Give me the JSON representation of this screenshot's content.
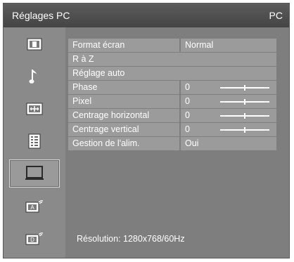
{
  "header": {
    "title": "Réglages PC",
    "source": "PC"
  },
  "sidebar": {
    "items": [
      {
        "icon": "picture-icon"
      },
      {
        "icon": "music-note-icon"
      },
      {
        "icon": "screen-adjust-icon"
      },
      {
        "icon": "feature-list-icon"
      },
      {
        "icon": "pc-monitor-icon",
        "selected": true
      },
      {
        "icon": "analog-setup-icon",
        "badge": "A"
      },
      {
        "icon": "digital-setup-icon",
        "badge": "D"
      }
    ]
  },
  "menu": {
    "rows": [
      {
        "label": "Format écran",
        "value": "Normal"
      },
      {
        "label": "R à Z"
      },
      {
        "label": "Réglage auto"
      },
      {
        "label": "Phase",
        "value": "0",
        "slider_level": 0.5
      },
      {
        "label": "Pixel",
        "value": "0",
        "slider_level": 0.5
      },
      {
        "label": "Centrage horizontal",
        "value": "0",
        "slider_level": 0.5
      },
      {
        "label": "Centrage vertical",
        "value": "0",
        "slider_level": 0.5
      },
      {
        "label": "Gestion de l'alim.",
        "value": "Oui"
      }
    ]
  },
  "footer": {
    "resolution": "Résolution: 1280x768/60Hz"
  }
}
